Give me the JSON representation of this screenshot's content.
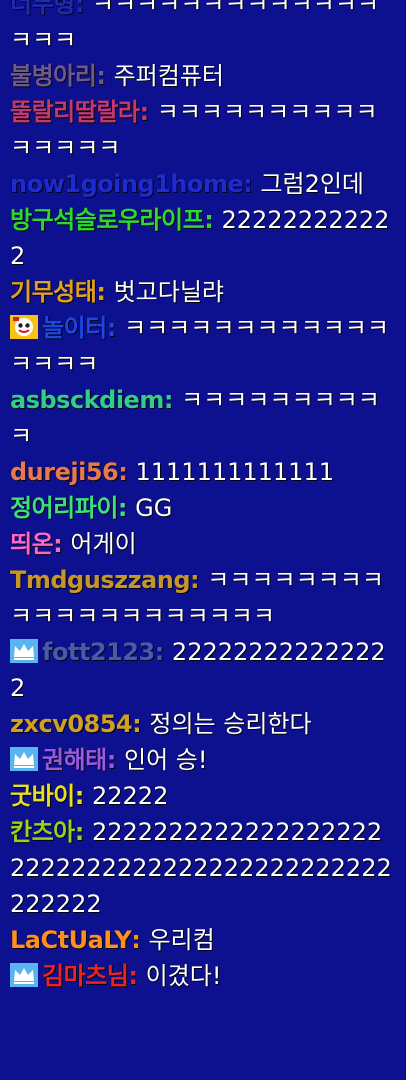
{
  "messages": [
    {
      "user": "너두형",
      "text": "ㅋㅋㅋㅋㅋㅋㅋㅋㅋㅋㅋㅋㅋㅋㅋㅋ",
      "color": "#1e2bb8",
      "badge": null
    },
    {
      "user": "불병아리",
      "text": "주퍼컴퓨터",
      "color": "#6e5a8a",
      "badge": null
    },
    {
      "user": "뚤랄리딸랄라",
      "text": "ㅋㅋㅋㅋㅋㅋㅋㅋㅋㅋㅋㅋㅋㅋㅋ",
      "color": "#c23a6a",
      "badge": null
    },
    {
      "user": "now1going1home",
      "text": "그럼2인데",
      "color": "#1e2bd0",
      "badge": null
    },
    {
      "user": "방구석슬로우라이프",
      "text": "222222222222",
      "color": "#2fd82f",
      "badge": null
    },
    {
      "user": "기무성태",
      "text": "벗고다닐랴",
      "color": "#e0a020",
      "badge": null
    },
    {
      "user": "놀이터",
      "text": "ㅋㅋㅋㅋㅋㅋㅋㅋㅋㅋㅋㅋㅋㅋㅋㅋ",
      "color": "#2046e0",
      "badge": "emoji"
    },
    {
      "user": "asbsckdiem",
      "text": "ㅋㅋㅋㅋㅋㅋㅋㅋㅋㅋ",
      "color": "#33cc88",
      "badge": null
    },
    {
      "user": "dureji56",
      "text": "1111111111111",
      "color": "#e87a4a",
      "badge": null
    },
    {
      "user": "정어리파이",
      "text": "GG",
      "color": "#3fe07a",
      "badge": null
    },
    {
      "user": "띄온",
      "text": "어게이",
      "color": "#ff66cc",
      "badge": null
    },
    {
      "user": "Tmdguszzang",
      "text": "ㅋㅋㅋㅋㅋㅋㅋㅋㅋㅋㅋㅋㅋㅋㅋㅋㅋㅋㅋㅋ",
      "color": "#c89628",
      "badge": null
    },
    {
      "user": "fott2123",
      "text": "222222222222222",
      "color": "#4a5aa8",
      "badge": "crown"
    },
    {
      "user": "zxcv0854",
      "text": "정의는 승리한다",
      "color": "#d0a020",
      "badge": null
    },
    {
      "user": "권해태",
      "text": "인어 승!",
      "color": "#9a5ae0",
      "badge": "crown"
    },
    {
      "user": "굿바이",
      "text": "22222",
      "color": "#e6e020",
      "badge": null
    },
    {
      "user": "칸츠아",
      "text": "22222222222222222222222222222222222222222222222222",
      "color": "#9ad020",
      "badge": null
    },
    {
      "user": "LaCtUaLY",
      "text": "우리컴",
      "color": "#ff9020",
      "badge": null
    },
    {
      "user": "김마츠님",
      "text": "이겼다!",
      "color": "#ee2222",
      "badge": "crown"
    }
  ],
  "separator": ":"
}
